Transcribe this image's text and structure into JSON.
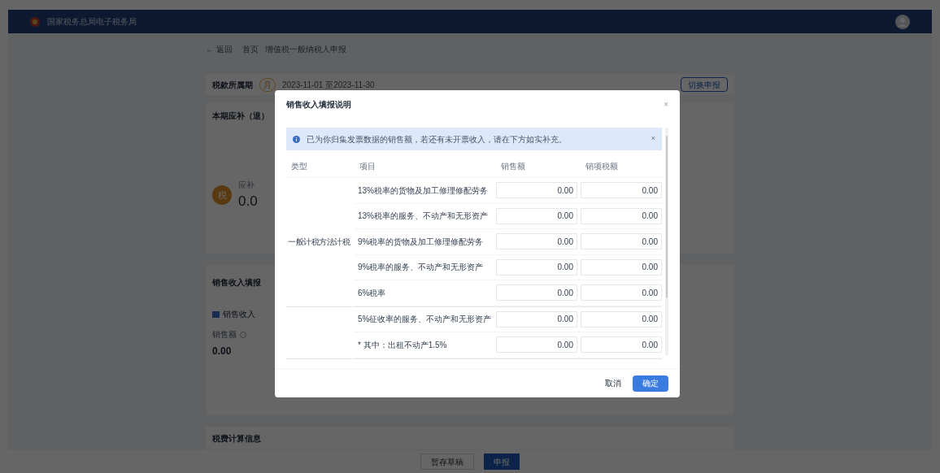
{
  "header": {
    "title": "国家税务总局电子税务局"
  },
  "breadcrumb": {
    "back": "← 返回",
    "items": [
      "首页",
      "增值税一般纳税人申报"
    ]
  },
  "period": {
    "label": "税款所属期",
    "badge": "月",
    "value": "2023-11-01 至2023-11-30",
    "button": "切换申报"
  },
  "summary": {
    "title": "本期应补（退）",
    "coin": "税",
    "caption": "应补",
    "amount": "0.0"
  },
  "sales_card": {
    "title": "销售收入填报",
    "chip": "销售收入",
    "field_label": "销售额",
    "value": "0.00"
  },
  "calc_card": {
    "title": "税费计算信息"
  },
  "footer": {
    "draft": "暂存草稿",
    "submit": "申报"
  },
  "modal": {
    "title": "销售收入填报说明",
    "close": "×",
    "banner": {
      "text": "已为你归集发票数据的销售额，若还有未开票收入，请在下方如实补充。",
      "close": "×"
    },
    "columns": [
      "类型",
      "项目",
      "销售额",
      "销项税额"
    ],
    "groups": [
      {
        "type": "一般计税方法计税",
        "rows": [
          {
            "item": "13%税率的货物及加工修理修配劳务",
            "sales": "0.00",
            "tax": "0.00"
          },
          {
            "item": "13%税率的服务、不动产和无形资产",
            "sales": "0.00",
            "tax": "0.00"
          },
          {
            "item": "9%税率的货物及加工修理修配劳务",
            "sales": "0.00",
            "tax": "0.00"
          },
          {
            "item": "9%税率的服务、不动产和无形资产",
            "sales": "0.00",
            "tax": "0.00"
          },
          {
            "item": "6%税率",
            "sales": "0.00",
            "tax": "0.00"
          }
        ]
      },
      {
        "rows": [
          {
            "item": "5%征收率的服务、不动产和无形资产",
            "sales": "0.00",
            "tax": "0.00"
          },
          {
            "item": "* 其中：出租不动产1.5%",
            "sales": "0.00",
            "tax": "0.00"
          }
        ]
      }
    ],
    "buttons": {
      "cancel": "取消",
      "ok": "确定"
    }
  }
}
